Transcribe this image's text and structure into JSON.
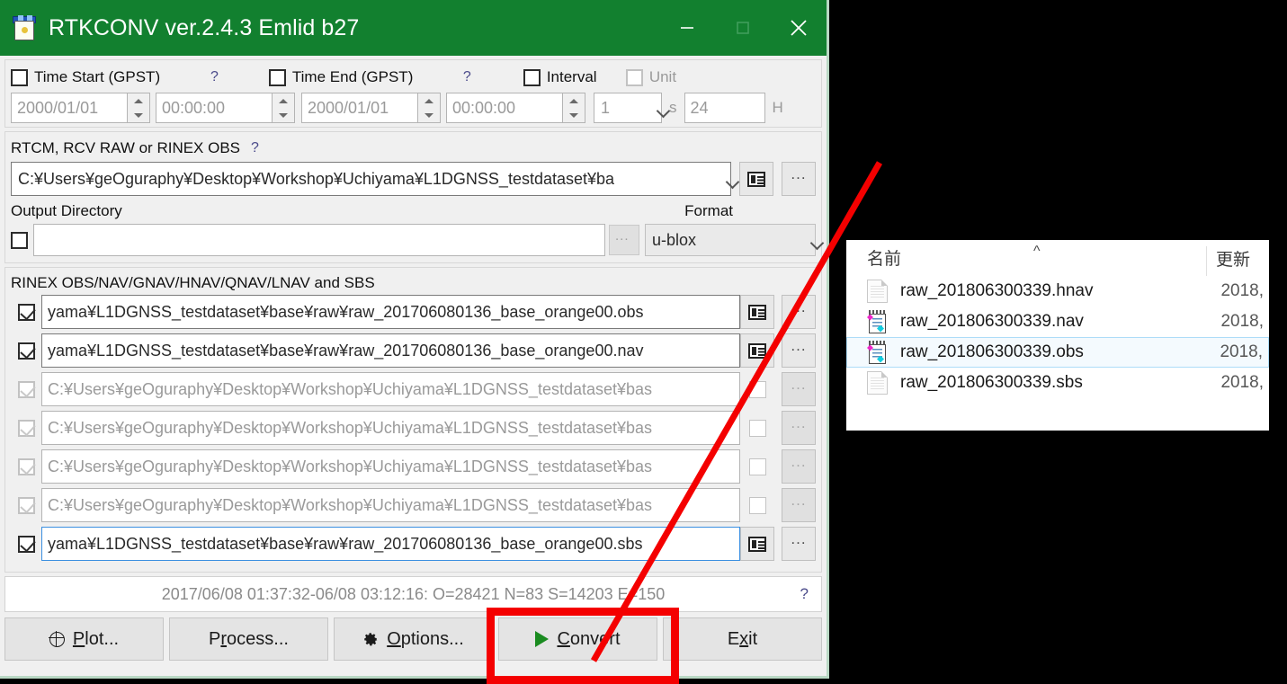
{
  "window": {
    "title": "RTKCONV ver.2.4.3 Emlid b27",
    "icon": "rtkconv-app-icon",
    "titlebar_color": "#12802f",
    "buttons": {
      "minimize": "minimize-icon",
      "maximize": "maximize-icon",
      "close": "close-icon"
    }
  },
  "time_section": {
    "time_start": {
      "label": "Time Start (GPST)",
      "checked": false,
      "help": "?",
      "date": "2000/01/01",
      "time": "00:00:00"
    },
    "time_end": {
      "label": "Time End (GPST)",
      "checked": false,
      "help": "?",
      "date": "2000/01/01",
      "time": "00:00:00"
    },
    "interval": {
      "label": "Interval",
      "checked": false,
      "value": "1",
      "unit_suffix": "s"
    },
    "unit": {
      "label": "Unit",
      "checked": false,
      "value": "24",
      "unit_suffix": "H"
    }
  },
  "input_section": {
    "label": "RTCM, RCV RAW or RINEX OBS",
    "help": "?",
    "path": "C:¥Users¥geOguraphy¥Desktop¥Workshop¥Uchiyama¥L1DGNSS_testdataset¥ba",
    "view_button": "view-file-icon",
    "browse_button": "...",
    "output_dir": {
      "label": "Output Directory",
      "checked": false,
      "value": "",
      "browse_button": "..."
    },
    "format": {
      "label": "Format",
      "value": "u-blox"
    }
  },
  "rinex_section": {
    "label": "RINEX OBS/NAV/GNAV/HNAV/QNAV/LNAV and SBS",
    "rows": [
      {
        "checked": true,
        "enabled": true,
        "focused": false,
        "path": "yama¥L1DGNSS_testdataset¥base¥raw¥raw_201706080136_base_orange00.obs",
        "view": true
      },
      {
        "checked": true,
        "enabled": true,
        "focused": false,
        "path": "yama¥L1DGNSS_testdataset¥base¥raw¥raw_201706080136_base_orange00.nav",
        "view": true
      },
      {
        "checked": true,
        "enabled": false,
        "focused": false,
        "path": "C:¥Users¥geOguraphy¥Desktop¥Workshop¥Uchiyama¥L1DGNSS_testdataset¥bas",
        "view": false
      },
      {
        "checked": true,
        "enabled": false,
        "focused": false,
        "path": "C:¥Users¥geOguraphy¥Desktop¥Workshop¥Uchiyama¥L1DGNSS_testdataset¥bas",
        "view": false
      },
      {
        "checked": true,
        "enabled": false,
        "focused": false,
        "path": "C:¥Users¥geOguraphy¥Desktop¥Workshop¥Uchiyama¥L1DGNSS_testdataset¥bas",
        "view": false
      },
      {
        "checked": true,
        "enabled": false,
        "focused": false,
        "path": "C:¥Users¥geOguraphy¥Desktop¥Workshop¥Uchiyama¥L1DGNSS_testdataset¥bas",
        "view": false
      },
      {
        "checked": true,
        "enabled": true,
        "focused": true,
        "path": "yama¥L1DGNSS_testdataset¥base¥raw¥raw_201706080136_base_orange00.sbs",
        "view": true
      }
    ]
  },
  "status_bar": {
    "text": "2017/06/08 01:37:32-06/08 03:12:16: O=28421 N=83 S=14203 E=150",
    "help": "?"
  },
  "buttons": [
    {
      "name": "plot",
      "label_pre": "",
      "label_accel": "P",
      "label_post": "lot...",
      "icon": "globe-icon"
    },
    {
      "name": "process",
      "label_pre": "P",
      "label_accel": "r",
      "label_post": "ocess...",
      "icon": null
    },
    {
      "name": "options",
      "label_pre": "",
      "label_accel": "O",
      "label_post": "ptions...",
      "icon": "gear-icon"
    },
    {
      "name": "convert",
      "label_pre": "",
      "label_accel": "C",
      "label_post": "onvert",
      "icon": "play-icon"
    },
    {
      "name": "exit",
      "label_pre": "E",
      "label_accel": "x",
      "label_post": "it",
      "icon": null
    }
  ],
  "explorer": {
    "columns": {
      "name": "名前",
      "modified": "更新",
      "sort_caret": "^"
    },
    "files": [
      {
        "name": "raw_201806300339.hnav",
        "date": "2018,",
        "icon": "plain-file-icon",
        "selected": false
      },
      {
        "name": "raw_201806300339.nav",
        "date": "2018,",
        "icon": "notepad-file-icon",
        "selected": false
      },
      {
        "name": "raw_201806300339.obs",
        "date": "2018,",
        "icon": "notepad-file-icon",
        "selected": true
      },
      {
        "name": "raw_201806300339.sbs",
        "date": "2018,",
        "icon": "plain-file-icon",
        "selected": false
      }
    ]
  },
  "annotation": {
    "highlight_color": "#f40000",
    "arrow_from_label": "convert-button",
    "arrow_to_label": "explorer-output-files"
  }
}
